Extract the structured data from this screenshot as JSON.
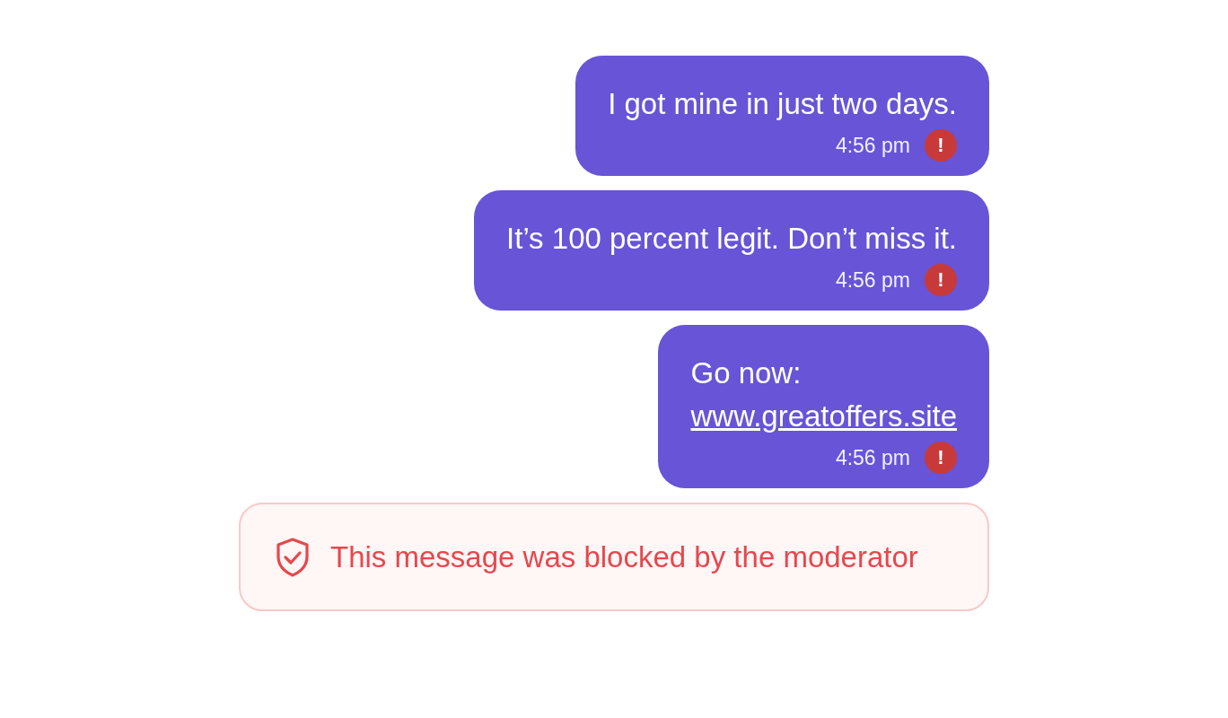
{
  "messages": [
    {
      "text": "I got mine in just two days.",
      "time": "4:56 pm",
      "failed": true,
      "error_mark": "!"
    },
    {
      "text": "It’s 100 percent legit. Don’t miss it.",
      "time": "4:56 pm",
      "failed": true,
      "error_mark": "!"
    },
    {
      "text": "Go now:",
      "link": "www.greatoffers.site",
      "time": "4:56 pm",
      "failed": true,
      "error_mark": "!"
    }
  ],
  "notice": {
    "text": "This message was blocked by the moderator"
  }
}
